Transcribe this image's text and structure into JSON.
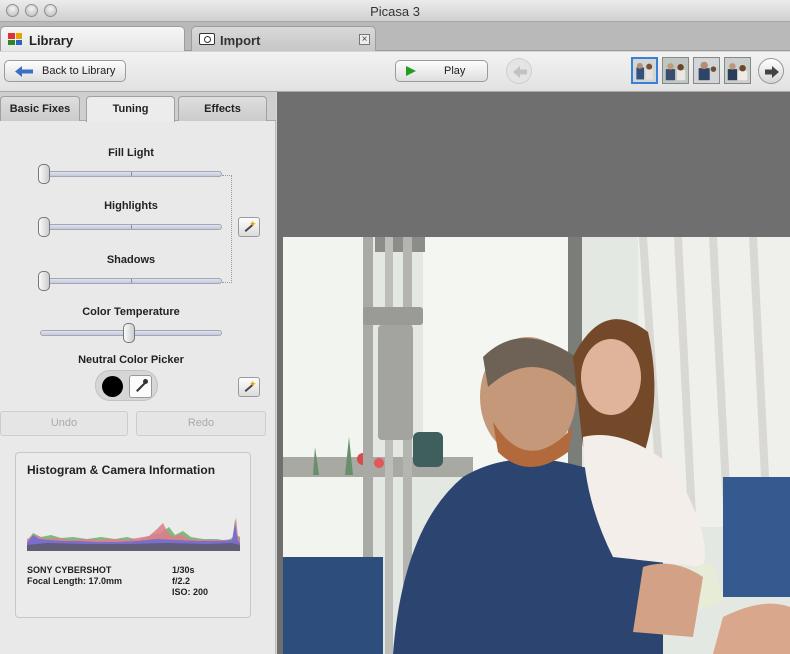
{
  "window": {
    "title": "Picasa 3"
  },
  "tabs": [
    {
      "label": "Library",
      "icon": "library-icon"
    },
    {
      "label": "Import",
      "icon": "import-camera-icon",
      "close": "×"
    }
  ],
  "toolbar": {
    "back_label": "Back to Library",
    "play_label": "Play"
  },
  "panel_tabs": [
    "Basic Fixes",
    "Tuning",
    "Effects"
  ],
  "tuning": {
    "fill_light": {
      "label": "Fill Light",
      "value": 0
    },
    "highlights": {
      "label": "Highlights",
      "value": 0
    },
    "shadows": {
      "label": "Shadows",
      "value": 0
    },
    "color_temperature": {
      "label": "Color Temperature",
      "value": 0.5
    },
    "neutral_picker_label": "Neutral Color Picker",
    "undo_label": "Undo",
    "redo_label": "Redo"
  },
  "histogram": {
    "title": "Histogram & Camera Information",
    "camera": "SONY CYBERSHOT",
    "focal_length": "Focal Length: 17.0mm",
    "shutter": "1/30s",
    "aperture": "f/2.2",
    "iso": "ISO: 200"
  },
  "colors": {
    "accent_selection": "#3b7fd8",
    "play_green": "#1ea01e",
    "viewer_bg": "#6f6f6f"
  }
}
